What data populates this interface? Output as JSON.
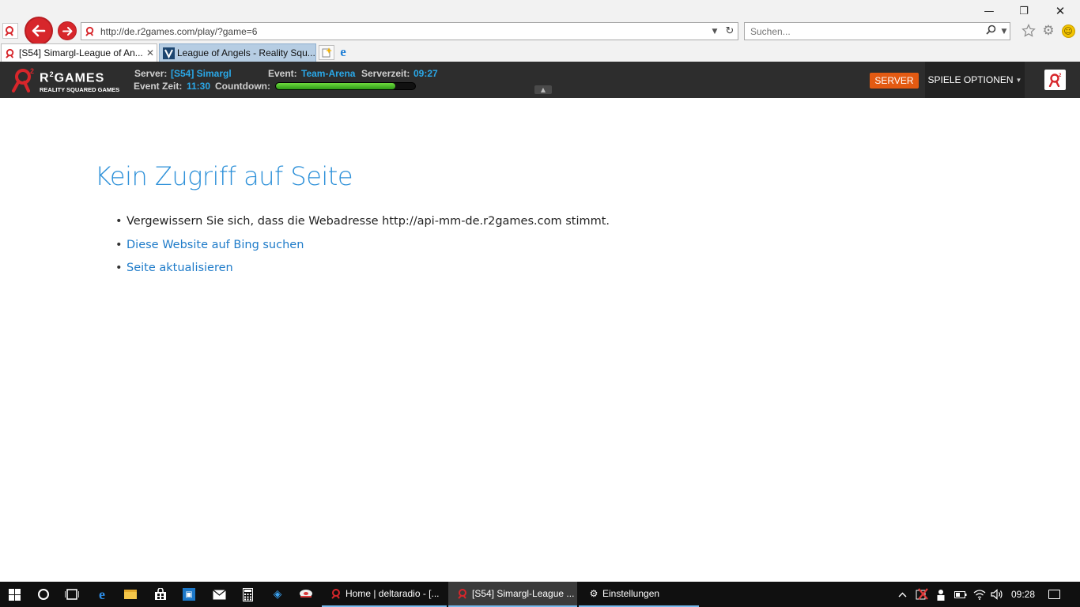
{
  "browser": {
    "window_controls": {
      "minimize": "—",
      "maximize": "❐",
      "close": "✕"
    },
    "address": {
      "url": "http://de.r2games.com/play/?game=6",
      "dropdown": "▼",
      "refresh": "↻"
    },
    "search": {
      "placeholder": "Suchen...",
      "icon": "search-icon",
      "dropdown": "▼"
    },
    "toolbar_icons": [
      "favorites-star-icon",
      "tools-gear-icon",
      "feedback-smiley-icon"
    ],
    "tabs": [
      {
        "label": "[S54] Simargl-League of An...",
        "active": true
      },
      {
        "label": "League of Angels - Reality Squ...",
        "active": false
      }
    ]
  },
  "r2bar": {
    "logo": {
      "brand": "R",
      "brand_sup": "2",
      "brand_rest": "GAMES",
      "sub": "REALITY SQUARED GAMES",
      "color": "#d7262b"
    },
    "server_label": "Server:",
    "server_value": "[S54] Simargl",
    "event_label": "Event:",
    "event_value": "Team-Arena",
    "servertime_label": "Serverzeit:",
    "servertime_value": "09:27",
    "eventtime_label": "Event Zeit:",
    "eventtime_value": "11:30",
    "countdown_label": "Countdown:",
    "countdown_fraction": 0.86,
    "server_button": "SERVER",
    "options_button": "SPIELE OPTIONEN",
    "accent": "#e35a12",
    "value_color": "#2aa8e8"
  },
  "error_page": {
    "title": "Kein Zugriff auf Seite",
    "items": [
      {
        "text": "Vergewissern Sie sich, dass die Webadresse http://api-mm-de.r2games.com stimmt.",
        "link": false
      },
      {
        "text": "Diese Website auf Bing suchen",
        "link": true
      },
      {
        "text": "Seite aktualisieren",
        "link": true
      }
    ],
    "title_color": "#2e91d9",
    "link_color": "#1e7bc9"
  },
  "taskbar": {
    "pinned": [
      "start-icon",
      "cortana-icon",
      "task-view-icon",
      "edge-icon",
      "file-explorer-icon",
      "store-icon",
      "app-icon",
      "mail-icon",
      "calculator-icon",
      "media-player-icon",
      "disk-icon"
    ],
    "tasks": [
      {
        "label": "Home | deltaradio - [...",
        "active": false
      },
      {
        "label": "[S54] Simargl-League ...",
        "active": true
      },
      {
        "label": "Einstellungen",
        "active": false
      }
    ],
    "clock": "09:28"
  }
}
